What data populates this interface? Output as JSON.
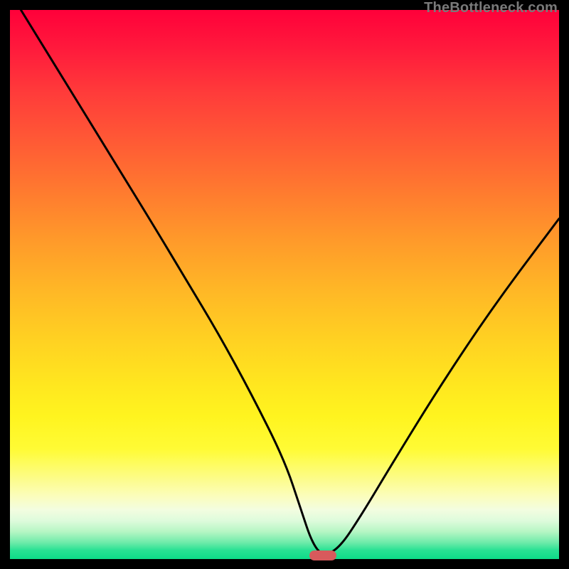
{
  "watermark": "TheBottleneck.com",
  "colors": {
    "frame": "#000000",
    "curve": "#000000",
    "marker": "#d85a5c"
  },
  "chart_data": {
    "type": "line",
    "title": "",
    "xlabel": "",
    "ylabel": "",
    "xlim": [
      0,
      100
    ],
    "ylim": [
      0,
      100
    ],
    "grid": false,
    "legend": false,
    "note": "Values estimated from pixel positions; axes are unlabeled. y = bottleneck percentage (0 at bottom / green, 100 at top / red).",
    "series": [
      {
        "name": "bottleneck-curve",
        "x": [
          2,
          10,
          18,
          26,
          32,
          38,
          44,
          50,
          53,
          55,
          57,
          60,
          64,
          70,
          78,
          88,
          100
        ],
        "y": [
          100,
          87,
          74,
          61,
          51,
          41,
          30,
          18,
          9,
          3,
          0.5,
          2,
          8,
          18,
          31,
          46,
          62
        ]
      }
    ],
    "marker": {
      "name": "optimal-range",
      "x_start": 54.5,
      "x_end": 59.5,
      "y": 0.6
    }
  }
}
